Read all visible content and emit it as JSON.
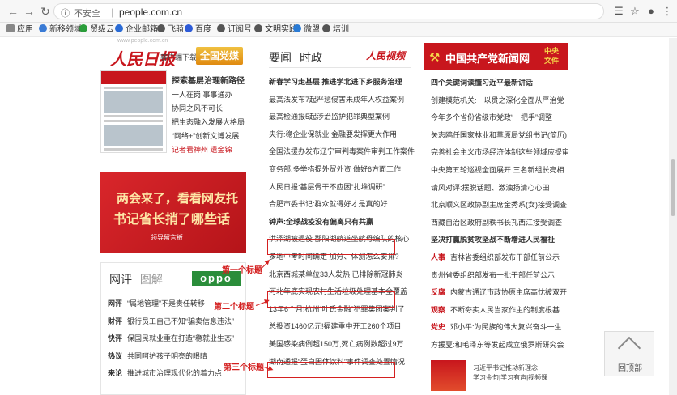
{
  "browser": {
    "insecure_label": "不安全",
    "url": "people.com.cn",
    "bookmarks": [
      "应用",
      "新移领域",
      "贸级云",
      "企业邮箱",
      "飞骑",
      "百度",
      "订阅号",
      "文明实践",
      "微盟",
      "培训"
    ]
  },
  "left": {
    "faint_text": "www.people.com.cn",
    "rmrb_logo": "人民日报",
    "client_download": "客户端下载",
    "dangmei": "全国党媒",
    "paper_items": [
      "探索基层治理新路径",
      "一人在岗 事事通办",
      "协同之风不可长",
      "把生态融入发展大格局",
      "“网络+”创新文博发展",
      "记者看神州 遗金锦"
    ],
    "banner_line1": "两会来了，看看网友托",
    "banner_line2": "书记省长捎了哪些话",
    "banner_brand": "领导留言板",
    "pinglun_tab": "网评",
    "tujie_tab": "图解",
    "oppo": "oppo",
    "pinglun_rows": [
      {
        "tag": "网评",
        "text": "“属地管理”不是责任转移"
      },
      {
        "tag": "财评",
        "text": "银行员工自己不知“骗卖信息违法”"
      },
      {
        "tag": "快评",
        "text": "保国民就业重在打造“稳就业生态”"
      },
      {
        "tag": "热议",
        "text": "共同呵护孩子明亮的眼睛"
      },
      {
        "tag": "来论",
        "text": "推进城市治理现代化的着力点"
      }
    ]
  },
  "middle": {
    "tab1": "要闻",
    "tab2": "时政",
    "video_logo": "人民视频",
    "rows": [
      {
        "text": "新春学习走基层  推进学北进下乡服务治理",
        "bold": true
      },
      {
        "text": "最高法发布7起严惩侵害未成年人权益案例",
        "bold": false
      },
      {
        "text": "最高检通报5起涉治监护犯罪典型案例",
        "bold": false
      },
      {
        "text": "央行:稳企业保就业 金融要发挥更大作用",
        "bold": false
      },
      {
        "text": "全国法援办发布辽宁审判毒案件审判工作案件",
        "bold": false
      },
      {
        "text": "商务部:多举措提外贸外资 做好6方面工作",
        "bold": false
      },
      {
        "text": "人民日报:基层骨干不应困“扎堆调研”",
        "bold": false
      },
      {
        "text": "合肥市委书记:群众就得好才是真的好",
        "bold": false
      },
      {
        "text": "钟声:全球战疫没有偏离只有共赢",
        "bold": true
      },
      {
        "text": "洪泽湖被退役 鄱阳湖航道坐航母编队的核心",
        "bold": false
      },
      {
        "text": "多地中考时间确定 加分、体测怎么安排?",
        "bold": false
      },
      {
        "text": "北京西城某单位33人发热 已排除新冠肺炎",
        "bold": false
      },
      {
        "text": "河北年底实现农村生活垃圾处理基本全覆盖",
        "bold": false
      },
      {
        "text": "13年6个月!杭州“叶氏金融”犯罪集团案判了",
        "bold": false
      },
      {
        "text": "总投资1460亿元!福建重中开工260个项目",
        "bold": false
      },
      {
        "text": "美国感染病例超150万,死亡病例数超过9万",
        "bold": false
      },
      {
        "text": "湖南通报“蛋白固体饮料”事件调查处置情况",
        "bold": false
      }
    ]
  },
  "annotations": {
    "first": "第一个标题",
    "second": "第二个标题",
    "third": "第三个标题"
  },
  "right": {
    "party_title": "中国共产党新闻网",
    "party_tag": "中央文件",
    "rows": [
      {
        "tag": "",
        "text": "四个关键词读懂习近平最新讲话",
        "bold": true
      },
      {
        "tag": "",
        "text": "创建模范机关:一以贯之深化全面从严治党",
        "bold": false
      },
      {
        "tag": "",
        "text": "今年多个省份省级市党政“一把手”调整",
        "bold": false
      },
      {
        "tag": "",
        "text": "关志鸥任国家林业和草原局党组书记(简历)",
        "bold": false
      },
      {
        "tag": "",
        "text": "完善社会主义市场经济体制这些领域应提审",
        "bold": false
      },
      {
        "tag": "",
        "text": "中央第五轮巡视全面展开 三名新组长亮相",
        "bold": false
      },
      {
        "tag": "",
        "text": "请风对评:摆脱话题、激浊扬清心心田",
        "bold": false
      },
      {
        "tag": "",
        "text": "北京顺义区政协副主席金秀系(女)接受调查",
        "bold": false
      },
      {
        "tag": "",
        "text": "西藏自治区政府副秩书长孔西江接受调查",
        "bold": false
      },
      {
        "tag": "",
        "text": "坚决打赢脱贫攻坚战不断增进人民福祉",
        "bold": true
      },
      {
        "tag": "人事",
        "text": "吉林省委组织部发布干部任前公示",
        "bold": false
      },
      {
        "tag": "",
        "text": "贵州省委组织部发布一批干部任前公示",
        "bold": false
      },
      {
        "tag": "反腐",
        "text": "内蒙古通辽市政协原主席高忱被双开",
        "bold": false
      },
      {
        "tag": "观察",
        "text": "不断夯实人民当家作主的制度根基",
        "bold": false
      },
      {
        "tag": "党史",
        "text": "邓小平:为民族的伟大复兴奋斗一生",
        "bold": false
      },
      {
        "tag": "",
        "text": "方援夏:和毛泽东等发起成立俄罗斯研究会",
        "bold": false
      }
    ],
    "thumb_lines": [
      "习近平书记推动新理念",
      "学习金句|学习有声|视频课"
    ]
  },
  "back_top": "回顶部"
}
